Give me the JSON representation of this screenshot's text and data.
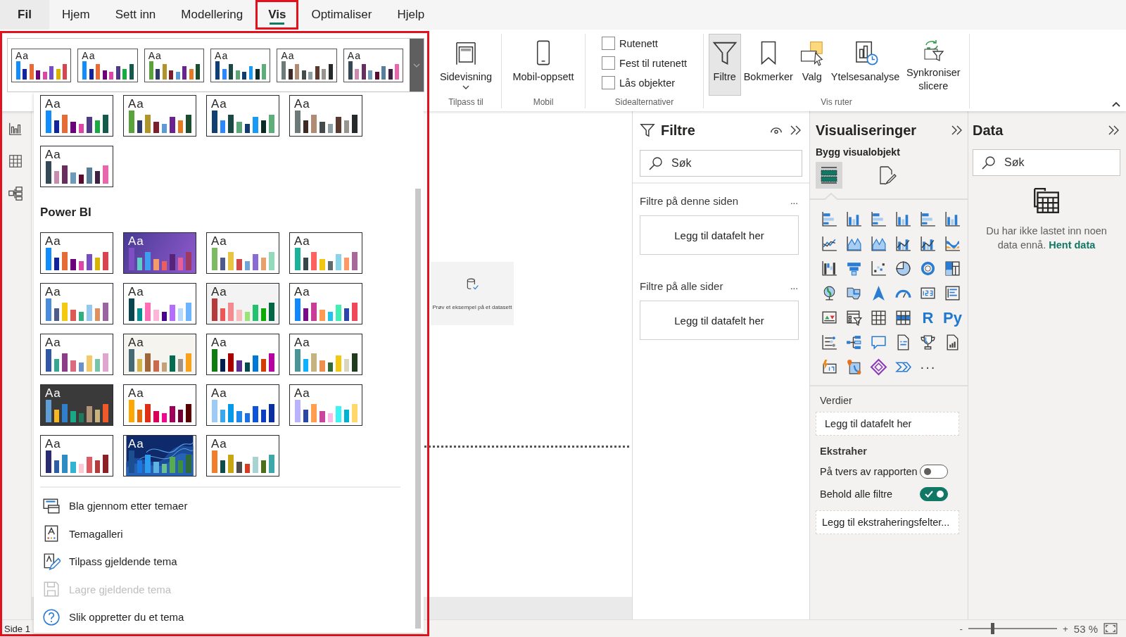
{
  "menu_tabs": [
    {
      "kind": "file",
      "label": "Fil",
      "selected": false
    },
    {
      "kind": "tab",
      "label": "Hjem",
      "selected": false
    },
    {
      "kind": "tab",
      "label": "Sett inn",
      "selected": false
    },
    {
      "kind": "tab",
      "label": "Modellering",
      "selected": false
    },
    {
      "kind": "tab",
      "label": "Vis",
      "selected": true,
      "highlighted": true
    },
    {
      "kind": "tab",
      "label": "Optimaliser",
      "selected": false
    },
    {
      "kind": "tab",
      "label": "Hjelp",
      "selected": false
    }
  ],
  "ribbon": {
    "groups": [
      {
        "label": "Tilpass til",
        "items": [
          {
            "kind": "pageview",
            "label": "Sidevisning"
          }
        ]
      },
      {
        "label": "Mobil",
        "items": [
          {
            "kind": "phone",
            "label": "Mobil-oppsett"
          }
        ]
      },
      {
        "label": "Sidealternativer",
        "items": [
          {
            "kind": "checkbox",
            "label": "Rutenett",
            "checked": false
          },
          {
            "kind": "checkbox",
            "label": "Fest til rutenett",
            "checked": false
          },
          {
            "kind": "checkbox",
            "label": "Lås objekter",
            "checked": false
          }
        ]
      },
      {
        "label": "Vis ruter",
        "items": [
          {
            "kind": "filter",
            "label": "Filtre",
            "selected": true
          },
          {
            "kind": "bookmark",
            "label": "Bokmerker",
            "selected": false
          },
          {
            "kind": "selection",
            "label": "Valg",
            "selected": false
          },
          {
            "kind": "performance",
            "label": "Ytelsesanalyse",
            "selected": false
          },
          {
            "kind": "sync",
            "label": "Synkroniser slicere",
            "selected": false
          }
        ]
      }
    ]
  },
  "theme_menu": {
    "highlighted": true,
    "gallery": [
      {
        "label": "Aa",
        "color": "#ffffff",
        "bars": [
          {
            "color": "#118dff"
          },
          {
            "color": "#12239e"
          },
          {
            "color": "#e66c37"
          },
          {
            "color": "#6b007b"
          },
          {
            "color": "#e044a7"
          },
          {
            "color": "#744ec2"
          },
          {
            "color": "#d9b300"
          },
          {
            "color": "#d64550"
          }
        ]
      },
      {
        "label": "Aa",
        "color": "#ffffff",
        "bars": [
          {
            "color": "#118dff"
          },
          {
            "color": "#12239e"
          },
          {
            "color": "#e66c37"
          },
          {
            "color": "#6b007b"
          },
          {
            "color": "#e044a7"
          },
          {
            "color": "#4f3a8a"
          },
          {
            "color": "#1aab40"
          },
          {
            "color": "#15584c"
          }
        ]
      },
      {
        "label": "Aa",
        "color": "#ffffff",
        "bars": [
          {
            "color": "#5aa33c"
          },
          {
            "color": "#2c3a6e"
          },
          {
            "color": "#b0962a"
          },
          {
            "color": "#7a1f2c"
          },
          {
            "color": "#5d9bd6"
          },
          {
            "color": "#6b2391"
          },
          {
            "color": "#e57a21"
          },
          {
            "color": "#1b4d2e"
          }
        ]
      },
      {
        "label": "Aa",
        "color": "#ffffff",
        "bars": [
          {
            "color": "#0f3f73"
          },
          {
            "color": "#2d88ff"
          },
          {
            "color": "#1b4a45"
          },
          {
            "color": "#5aa878"
          },
          {
            "color": "#123b6e"
          },
          {
            "color": "#179bf5"
          },
          {
            "color": "#0c2b25"
          },
          {
            "color": "#5fae7a"
          }
        ]
      },
      {
        "label": "Aa",
        "color": "#ffffff",
        "bars": [
          {
            "color": "#6d7a78"
          },
          {
            "color": "#3b2a27"
          },
          {
            "color": "#b08c74"
          },
          {
            "color": "#454b4b"
          },
          {
            "color": "#8d9ea3"
          },
          {
            "color": "#5a3a2e"
          },
          {
            "color": "#98958f"
          },
          {
            "color": "#262a2a"
          }
        ]
      },
      {
        "label": "Aa",
        "color": "#ffffff",
        "bars": [
          {
            "color": "#344a57"
          },
          {
            "color": "#c98bb0"
          },
          {
            "color": "#662f5e"
          },
          {
            "color": "#6f9bbb"
          },
          {
            "color": "#5b0b2e"
          },
          {
            "color": "#587f9a"
          },
          {
            "color": "#3e2140"
          },
          {
            "color": "#e866ae"
          }
        ]
      }
    ],
    "groups": [
      {
        "themes": [
          {
            "label": "Aa",
            "color": "#ffffff",
            "bars": [
              {
                "color": "#118dff"
              },
              {
                "color": "#12239e"
              },
              {
                "color": "#e66c37"
              },
              {
                "color": "#6b007b"
              },
              {
                "color": "#e044a7"
              },
              {
                "color": "#4f3a8a"
              },
              {
                "color": "#1aab40"
              },
              {
                "color": "#15584c"
              }
            ]
          },
          {
            "label": "Aa",
            "color": "#ffffff",
            "bars": [
              {
                "color": "#5aa33c"
              },
              {
                "color": "#2c3a6e"
              },
              {
                "color": "#b0962a"
              },
              {
                "color": "#7a1f2c"
              },
              {
                "color": "#5d9bd6"
              },
              {
                "color": "#6b2391"
              },
              {
                "color": "#e57a21"
              },
              {
                "color": "#1b4d2e"
              }
            ]
          },
          {
            "label": "Aa",
            "color": "#ffffff",
            "bars": [
              {
                "color": "#0f3f73"
              },
              {
                "color": "#2d88ff"
              },
              {
                "color": "#1b4a45"
              },
              {
                "color": "#5aa878"
              },
              {
                "color": "#123b6e"
              },
              {
                "color": "#179bf5"
              },
              {
                "color": "#0c2b25"
              },
              {
                "color": "#5fae7a"
              }
            ]
          },
          {
            "label": "Aa",
            "color": "#ffffff",
            "bars": [
              {
                "color": "#6d7a78"
              },
              {
                "color": "#3b2a27"
              },
              {
                "color": "#b08c74"
              },
              {
                "color": "#454b4b"
              },
              {
                "color": "#8d9ea3"
              },
              {
                "color": "#5a3a2e"
              },
              {
                "color": "#98958f"
              },
              {
                "color": "#262a2a"
              }
            ]
          },
          {
            "label": "Aa",
            "color": "#ffffff",
            "bars": [
              {
                "color": "#344a57"
              },
              {
                "color": "#c98bb0"
              },
              {
                "color": "#662f5e"
              },
              {
                "color": "#6f9bbb"
              },
              {
                "color": "#5b0b2e"
              },
              {
                "color": "#587f9a"
              },
              {
                "color": "#3e2140"
              },
              {
                "color": "#e866ae"
              }
            ]
          }
        ]
      },
      {
        "title": "Power BI",
        "themes": [
          {
            "label": "Aa",
            "color": "#ffffff",
            "bars": [
              {
                "color": "#118dff"
              },
              {
                "color": "#12239e"
              },
              {
                "color": "#e66c37"
              },
              {
                "color": "#6b007b"
              },
              {
                "color": "#e044a7"
              },
              {
                "color": "#744ec2"
              },
              {
                "color": "#d9b300"
              },
              {
                "color": "#d64550"
              }
            ]
          },
          {
            "label": "Aa",
            "kind": "gradient",
            "color": "#5a44a4",
            "bars": [
              {
                "color": "#7e4fc2"
              },
              {
                "color": "#5ecfc6"
              },
              {
                "color": "#3f9df2"
              },
              {
                "color": "#f59b6b"
              },
              {
                "color": "#ea5e5e"
              },
              {
                "color": "#57247a"
              },
              {
                "color": "#e85e99"
              },
              {
                "color": "#9e3a62"
              }
            ]
          },
          {
            "label": "Aa",
            "color": "#ffffff",
            "bars": [
              {
                "color": "#7dbb62"
              },
              {
                "color": "#4e5a8e"
              },
              {
                "color": "#e9c442"
              },
              {
                "color": "#d14a4a"
              },
              {
                "color": "#6ea6dc"
              },
              {
                "color": "#8a6ad4"
              },
              {
                "color": "#e9a06b"
              },
              {
                "color": "#93d9bb"
              }
            ]
          },
          {
            "label": "Aa",
            "color": "#ffffff",
            "bars": [
              {
                "color": "#1bb39a"
              },
              {
                "color": "#374649"
              },
              {
                "color": "#fd625e"
              },
              {
                "color": "#f2c80f"
              },
              {
                "color": "#5f6b6d"
              },
              {
                "color": "#8ad4eb"
              },
              {
                "color": "#fe9666"
              },
              {
                "color": "#a66999"
              }
            ]
          },
          {
            "label": "Aa",
            "color": "#ffffff",
            "bars": [
              {
                "color": "#4a8ddc"
              },
              {
                "color": "#4c5d8a"
              },
              {
                "color": "#f3c911"
              },
              {
                "color": "#dc5b57"
              },
              {
                "color": "#33ae81"
              },
              {
                "color": "#95c8f0"
              },
              {
                "color": "#dd915f"
              },
              {
                "color": "#9a64a0"
              }
            ]
          },
          {
            "label": "Aa",
            "color": "#ffffff",
            "bars": [
              {
                "color": "#074650"
              },
              {
                "color": "#009292"
              },
              {
                "color": "#fe6db6"
              },
              {
                "color": "#feb5da"
              },
              {
                "color": "#480091"
              },
              {
                "color": "#b66dff"
              },
              {
                "color": "#b5dafe"
              },
              {
                "color": "#6db6ff"
              }
            ]
          },
          {
            "label": "Aa",
            "color": "#f3f3f3",
            "bars": [
              {
                "color": "#b73a3a"
              },
              {
                "color": "#ec5656"
              },
              {
                "color": "#f28a90"
              },
              {
                "color": "#f8bcbd"
              },
              {
                "color": "#99e472"
              },
              {
                "color": "#23c26f"
              },
              {
                "color": "#0aac00"
              },
              {
                "color": "#026645"
              }
            ]
          },
          {
            "label": "Aa",
            "color": "#ffffff",
            "bars": [
              {
                "color": "#1288ff"
              },
              {
                "color": "#770b8a"
              },
              {
                "color": "#c83d95"
              },
              {
                "color": "#ff9a52"
              },
              {
                "color": "#1ec4e8"
              },
              {
                "color": "#41f0b1"
              },
              {
                "color": "#2b45ad"
              },
              {
                "color": "#f0475a"
              }
            ]
          },
          {
            "label": "Aa",
            "color": "#ffffff",
            "bars": [
              {
                "color": "#3257a8"
              },
              {
                "color": "#37a794"
              },
              {
                "color": "#8b3d88"
              },
              {
                "color": "#dd6b7f"
              },
              {
                "color": "#6b91c9"
              },
              {
                "color": "#f5c869"
              },
              {
                "color": "#77c4a8"
              },
              {
                "color": "#dea6cf"
              }
            ]
          },
          {
            "label": "Aa",
            "color": "#f6f4ee",
            "bars": [
              {
                "color": "#456a76"
              },
              {
                "color": "#d4b44a"
              },
              {
                "color": "#a1653b"
              },
              {
                "color": "#c96b4e"
              },
              {
                "color": "#c3a27a"
              },
              {
                "color": "#036c53"
              },
              {
                "color": "#a09488"
              },
              {
                "color": "#f8a21b"
              }
            ]
          },
          {
            "label": "Aa",
            "color": "#ffffff",
            "bars": [
              {
                "color": "#107c10"
              },
              {
                "color": "#002050"
              },
              {
                "color": "#a80000"
              },
              {
                "color": "#5c2d91"
              },
              {
                "color": "#004b50"
              },
              {
                "color": "#0078d7"
              },
              {
                "color": "#d83b01"
              },
              {
                "color": "#b4009e"
              }
            ]
          },
          {
            "label": "Aa",
            "color": "#ffffff",
            "bars": [
              {
                "color": "#4a9697"
              },
              {
                "color": "#0cb1ff"
              },
              {
                "color": "#c6b382"
              },
              {
                "color": "#ef8f4f"
              },
              {
                "color": "#2f6a38"
              },
              {
                "color": "#f2c811"
              },
              {
                "color": "#d8d6c0"
              },
              {
                "color": "#223c22"
              }
            ]
          },
          {
            "label": "Aa",
            "color": "#3a3a3a",
            "bars": [
              {
                "color": "#5f9fd6"
              },
              {
                "color": "#f5b724"
              },
              {
                "color": "#2f7fcb"
              },
              {
                "color": "#1aa889"
              },
              {
                "color": "#1e7a5d"
              },
              {
                "color": "#b09475"
              },
              {
                "color": "#c9b27c"
              },
              {
                "color": "#f05a2b"
              }
            ]
          },
          {
            "label": "Aa",
            "color": "#ffffff",
            "bars": [
              {
                "color": "#fda805"
              },
              {
                "color": "#e66c0a"
              },
              {
                "color": "#de2e15"
              },
              {
                "color": "#d6005a"
              },
              {
                "color": "#f20591"
              },
              {
                "color": "#a1005a"
              },
              {
                "color": "#730032"
              },
              {
                "color": "#570000"
              }
            ]
          },
          {
            "label": "Aa",
            "color": "#ffffff",
            "bars": [
              {
                "color": "#9ccbf7"
              },
              {
                "color": "#3aa8ef"
              },
              {
                "color": "#0798e8"
              },
              {
                "color": "#1f86eb"
              },
              {
                "color": "#1a70e6"
              },
              {
                "color": "#0e53db"
              },
              {
                "color": "#0b3dc5"
              },
              {
                "color": "#0a2e9d"
              }
            ]
          },
          {
            "label": "Aa",
            "color": "#ffffff",
            "bars": [
              {
                "color": "#b9b3ff"
              },
              {
                "color": "#2b47a6"
              },
              {
                "color": "#ff9e4f"
              },
              {
                "color": "#c9459b"
              },
              {
                "color": "#ffbae8"
              },
              {
                "color": "#3cf3f5"
              },
              {
                "color": "#00b2d2"
              },
              {
                "color": "#ffd76b"
              }
            ]
          },
          {
            "label": "Aa",
            "color": "#ffffff",
            "bars": [
              {
                "color": "#2a2b73"
              },
              {
                "color": "#2c5ea7"
              },
              {
                "color": "#2e8bc4"
              },
              {
                "color": "#35b3d2"
              },
              {
                "color": "#ffc9d3"
              },
              {
                "color": "#e05a62"
              },
              {
                "color": "#b53b3b"
              },
              {
                "color": "#8b1f26"
              }
            ]
          },
          {
            "label": "Aa",
            "kind": "picture",
            "bars": [
              {
                "color": "#1c4f8f"
              },
              {
                "color": "#1a78e0"
              },
              {
                "color": "#2d9bf0"
              },
              {
                "color": "#5fb3e3"
              },
              {
                "color": "#69c190"
              },
              {
                "color": "#5aab4e"
              },
              {
                "color": "#3d8f3d"
              },
              {
                "color": "#2e6b3a"
              }
            ]
          },
          {
            "label": "Aa",
            "color": "#ffffff",
            "bars": [
              {
                "color": "#f27d2a"
              },
              {
                "color": "#0e4d4a"
              },
              {
                "color": "#c9a714"
              },
              {
                "color": "#4d4d4d"
              },
              {
                "color": "#d93b22"
              },
              {
                "color": "#a8d3d3"
              },
              {
                "color": "#4f6e1c"
              },
              {
                "color": "#3ea7a9"
              }
            ]
          }
        ]
      }
    ],
    "actions": [
      {
        "kind": "browse",
        "label": "Bla gjennom etter temaer",
        "disabled": false
      },
      {
        "kind": "gallery",
        "label": "Temagalleri",
        "disabled": false
      },
      {
        "kind": "customize",
        "label": "Tilpass gjeldende tema",
        "disabled": false
      },
      {
        "kind": "save",
        "label": "Lagre gjeldende tema",
        "disabled": true
      },
      {
        "kind": "help",
        "label": "Slik oppretter du et tema",
        "disabled": false
      }
    ]
  },
  "canvas": {
    "sample_card": "Prøv et eksempel på et datasett"
  },
  "filters_pane": {
    "title": "Filtre",
    "search": {
      "placeholder": "Søk"
    },
    "sections": [
      {
        "title": "Filtre på denne siden",
        "more": "...",
        "drop_zone": "Legg til datafelt her"
      },
      {
        "title": "Filtre på alle sider",
        "more": "...",
        "drop_zone": "Legg til datafelt her"
      }
    ]
  },
  "visualizations_pane": {
    "title": "Visualiseringer",
    "subtitle": "Bygg visualobjekt",
    "modes": [
      {
        "kind": "build",
        "selected": true
      },
      {
        "kind": "format",
        "selected": false
      }
    ],
    "visuals": [
      {
        "kind": "hbar"
      },
      {
        "kind": "column"
      },
      {
        "kind": "hbar"
      },
      {
        "kind": "column"
      },
      {
        "kind": "hbar"
      },
      {
        "kind": "column"
      },
      {
        "kind": "line"
      },
      {
        "kind": "area"
      },
      {
        "kind": "area"
      },
      {
        "kind": "combo"
      },
      {
        "kind": "combo"
      },
      {
        "kind": "ribbon"
      },
      {
        "kind": "waterfall"
      },
      {
        "kind": "funnel"
      },
      {
        "kind": "scatter"
      },
      {
        "kind": "pie"
      },
      {
        "kind": "donut"
      },
      {
        "kind": "treemap"
      },
      {
        "kind": "globe"
      },
      {
        "kind": "shapemap"
      },
      {
        "kind": "arrow"
      },
      {
        "kind": "gauge"
      },
      {
        "kind": "card"
      },
      {
        "kind": "multicard"
      },
      {
        "kind": "kpi"
      },
      {
        "kind": "slicer"
      },
      {
        "kind": "table"
      },
      {
        "kind": "matrix"
      },
      {
        "kind": "script",
        "label": "R"
      },
      {
        "kind": "script",
        "label": "Py"
      },
      {
        "kind": "influencers"
      },
      {
        "kind": "tree"
      },
      {
        "kind": "qa"
      },
      {
        "kind": "narrative"
      },
      {
        "kind": "trophy"
      },
      {
        "kind": "paginated"
      },
      {
        "kind": "newcard"
      },
      {
        "kind": "pinmap"
      },
      {
        "kind": "apps"
      },
      {
        "kind": "automate"
      },
      {
        "kind": "more",
        "label": "···"
      }
    ],
    "wells": [
      {
        "title": "Verdier",
        "drop_zone": "Legg til datafelt her"
      }
    ],
    "drillthrough": {
      "title": "Ekstraher",
      "toggles": [
        {
          "label": "På tvers av rapporten",
          "on": false
        },
        {
          "label": "Behold alle filtre",
          "on": true
        }
      ],
      "drop_zone": "Legg til ekstraheringsfelter..."
    }
  },
  "data_pane": {
    "title": "Data",
    "search": {
      "placeholder": "Søk"
    },
    "message": "Du har ikke lastet inn noen data ennå.",
    "link": "Hent data"
  },
  "status_bar": {
    "page": "Side 1",
    "zoom": {
      "minus": "-",
      "plus": "+",
      "level": 0.27,
      "reading": "53 %"
    }
  }
}
